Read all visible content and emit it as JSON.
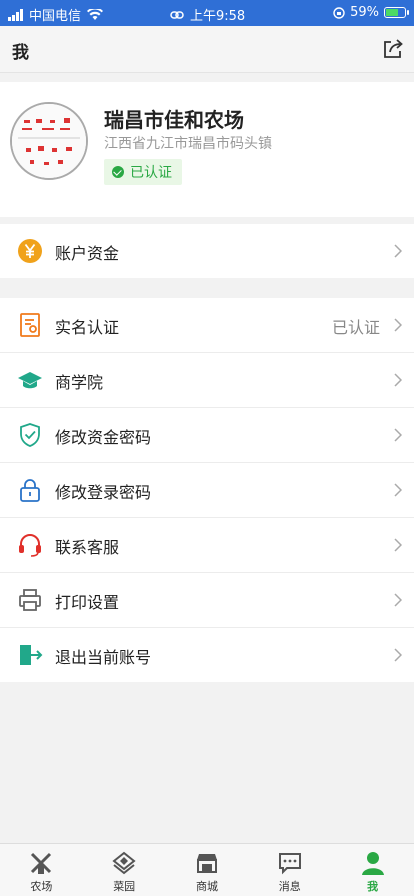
{
  "status_bar": {
    "carrier": "中国电信",
    "time": "上午9:58",
    "battery": "59%"
  },
  "header": {
    "title": "我"
  },
  "profile": {
    "name": "瑞昌市佳和农场",
    "address": "江西省九江市瑞昌市码头镇",
    "badge": "已认证"
  },
  "account_section": {
    "funds_label": "账户资金"
  },
  "menu": {
    "items": [
      {
        "label": "实名认证",
        "value": "已认证"
      },
      {
        "label": "商学院"
      },
      {
        "label": "修改资金密码"
      },
      {
        "label": "修改登录密码"
      },
      {
        "label": "联系客服"
      },
      {
        "label": "打印设置"
      },
      {
        "label": "退出当前账号"
      }
    ]
  },
  "tabbar": {
    "tabs": [
      {
        "label": "农场"
      },
      {
        "label": "菜园"
      },
      {
        "label": "商城"
      },
      {
        "label": "消息"
      },
      {
        "label": "我"
      }
    ],
    "active_index": 4
  },
  "colors": {
    "status_bar": "#2f6fd6",
    "accent_green": "#2aa844",
    "gold": "#f0a21b",
    "orange": "#f07a1b",
    "teal": "#21a88a",
    "blue": "#2a73c8",
    "red": "#e0302a",
    "gray_icon": "#666666"
  }
}
